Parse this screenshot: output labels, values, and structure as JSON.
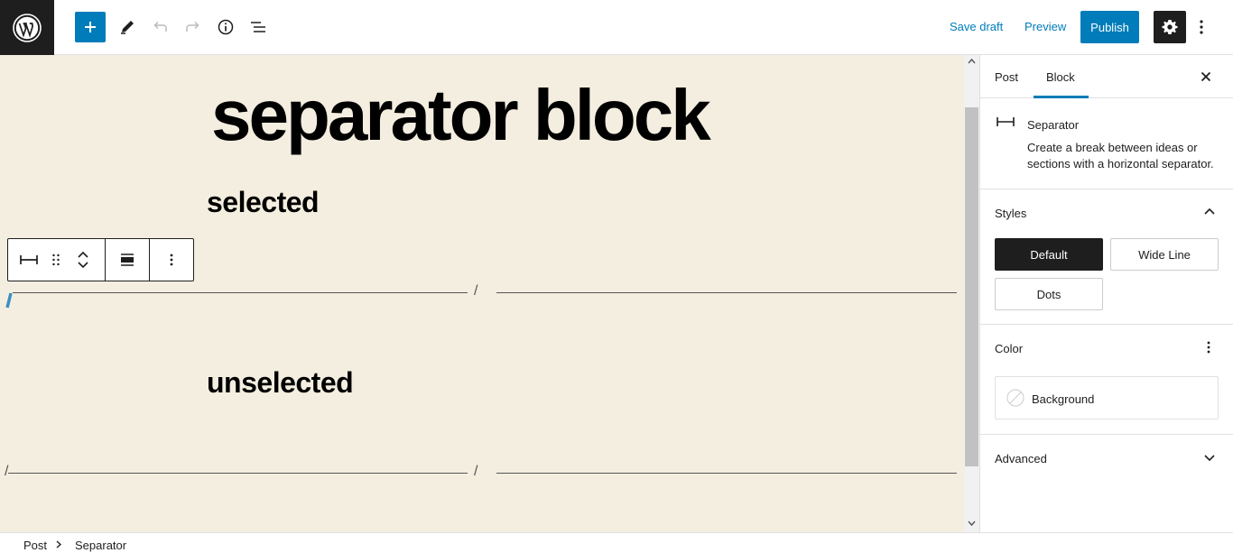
{
  "header": {
    "save_draft": "Save draft",
    "preview": "Preview",
    "publish": "Publish"
  },
  "canvas": {
    "title": "separator block",
    "selected_heading": "selected",
    "unselected_heading": "unselected",
    "slash": "/"
  },
  "sidebar": {
    "tabs": [
      {
        "label": "Post"
      },
      {
        "label": "Block"
      }
    ],
    "active_tab": "Block",
    "block": {
      "name": "Separator",
      "description": "Create a break between ideas or sections with a horizontal separator."
    },
    "styles": {
      "title": "Styles",
      "options": [
        {
          "label": "Default"
        },
        {
          "label": "Wide Line"
        },
        {
          "label": "Dots"
        }
      ],
      "selected": "Default"
    },
    "color": {
      "title": "Color",
      "background_label": "Background"
    },
    "advanced": {
      "title": "Advanced"
    }
  },
  "breadcrumb": {
    "items": [
      {
        "label": "Post"
      },
      {
        "label": "Separator"
      }
    ]
  },
  "colors": {
    "accent": "#007cba",
    "canvas_bg": "#f4eee0",
    "dark": "#1e1e1e"
  }
}
